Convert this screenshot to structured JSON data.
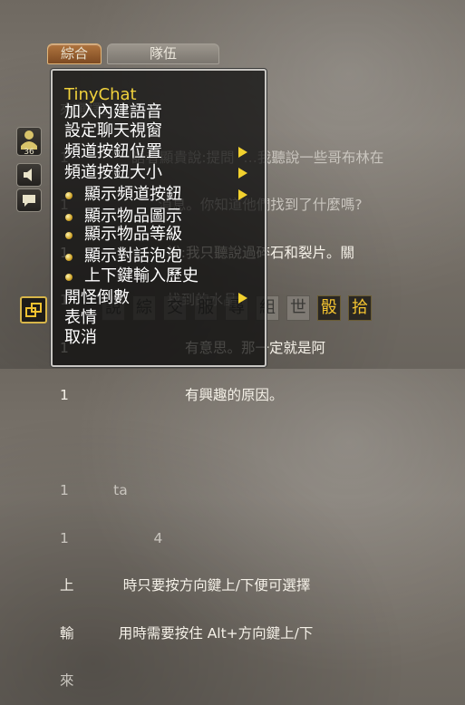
{
  "tabs": {
    "general": "綜合",
    "party": "隊伍"
  },
  "chat_log": [
    "來選擇。",
    "1              語者顯貴說:提問  …我聽說一些哥布林在",
    "1                    消息。你知道他們找到了什麼嗎?",
    "1                      說:我只聽說過碎石和裂片。關",
    "1                      找到的水晶?",
    "1                          有意思。那一定就是阿",
    "1                          有興趣的原因。",
    "",
    "1          ta",
    "1                   4",
    "上           時只要按方向鍵上/下便可選擇",
    "輸          用時需要按住 Alt+方向鍵上/下",
    "來"
  ],
  "menu": {
    "title": "TinyChat",
    "items": [
      {
        "label": "加入內建語音",
        "bullet": false,
        "arrow": false
      },
      {
        "label": "設定聊天視窗",
        "bullet": false,
        "arrow": false
      },
      {
        "label": "頻道按鈕位置",
        "bullet": false,
        "arrow": true
      },
      {
        "label": "頻道按鈕大小",
        "bullet": false,
        "arrow": true
      },
      {
        "label": "顯示頻道按鈕",
        "bullet": true,
        "arrow": true
      },
      {
        "label": "顯示物品圖示",
        "bullet": true,
        "arrow": false
      },
      {
        "label": "顯示物品等級",
        "bullet": true,
        "arrow": false
      },
      {
        "label": "顯示對話泡泡",
        "bullet": true,
        "arrow": false
      },
      {
        "label": "上下鍵輸入歷史",
        "bullet": true,
        "arrow": false
      },
      {
        "label": "開怪倒數",
        "bullet": false,
        "arrow": true
      },
      {
        "label": "表情",
        "bullet": false,
        "arrow": false
      },
      {
        "label": "取消",
        "bullet": false,
        "arrow": false
      }
    ]
  },
  "channels": [
    "說",
    "綜",
    "交",
    "服",
    "尋",
    "組",
    "世",
    "骰",
    "拾"
  ],
  "channel_active": [
    false,
    false,
    false,
    false,
    false,
    false,
    false,
    true,
    true
  ],
  "colors": {
    "menu_title": "#f0d13c",
    "accent": "#f2c230"
  }
}
